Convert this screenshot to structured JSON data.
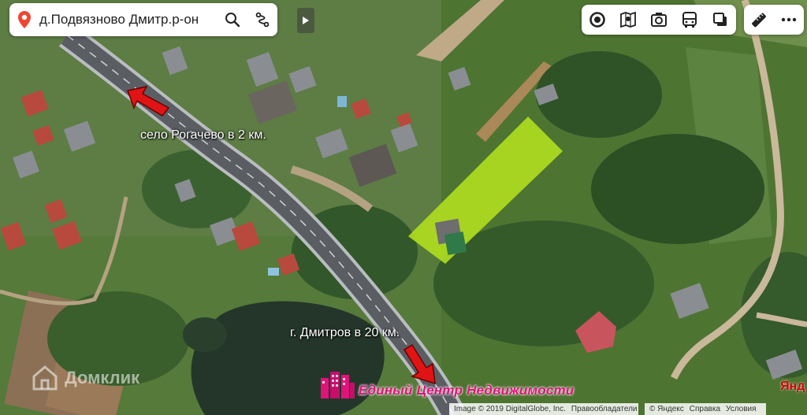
{
  "search": {
    "query": "д.Подвязново Дмитр.р-он",
    "icons": {
      "pin": "location-pin-icon",
      "search": "search-icon",
      "route": "route-icon"
    }
  },
  "toolbar": {
    "buttons": [
      {
        "name": "layers-button",
        "icon": "circle-layers-icon"
      },
      {
        "name": "panorama-button",
        "icon": "panorama-map-icon"
      },
      {
        "name": "photo-button",
        "icon": "camera-icon"
      },
      {
        "name": "transport-button",
        "icon": "bus-icon"
      },
      {
        "name": "map-type-button",
        "icon": "stacked-squares-icon"
      }
    ],
    "extra": [
      {
        "name": "ruler-button",
        "icon": "ruler-icon"
      },
      {
        "name": "more-button",
        "icon": "more-dots-icon"
      }
    ]
  },
  "labels": {
    "rogachevo": "село Рогачево  в 2 км.",
    "dmitrov": "г. Дмитров в 20 км."
  },
  "watermark": "Домклик",
  "agency": "Единый Центр Недвижимости",
  "yandex_logo": "Янд",
  "attribution": {
    "imagery": "Image © 2019 DigitalGlobe, Inc.",
    "rights": "Правообладатели",
    "copyright": "© Яндекс",
    "help": "Справка",
    "terms": "Условия"
  },
  "colors": {
    "plot": "#b4e11e",
    "arrow": "#e01414",
    "agency": "#e0137a",
    "pin": "#f0452f"
  }
}
